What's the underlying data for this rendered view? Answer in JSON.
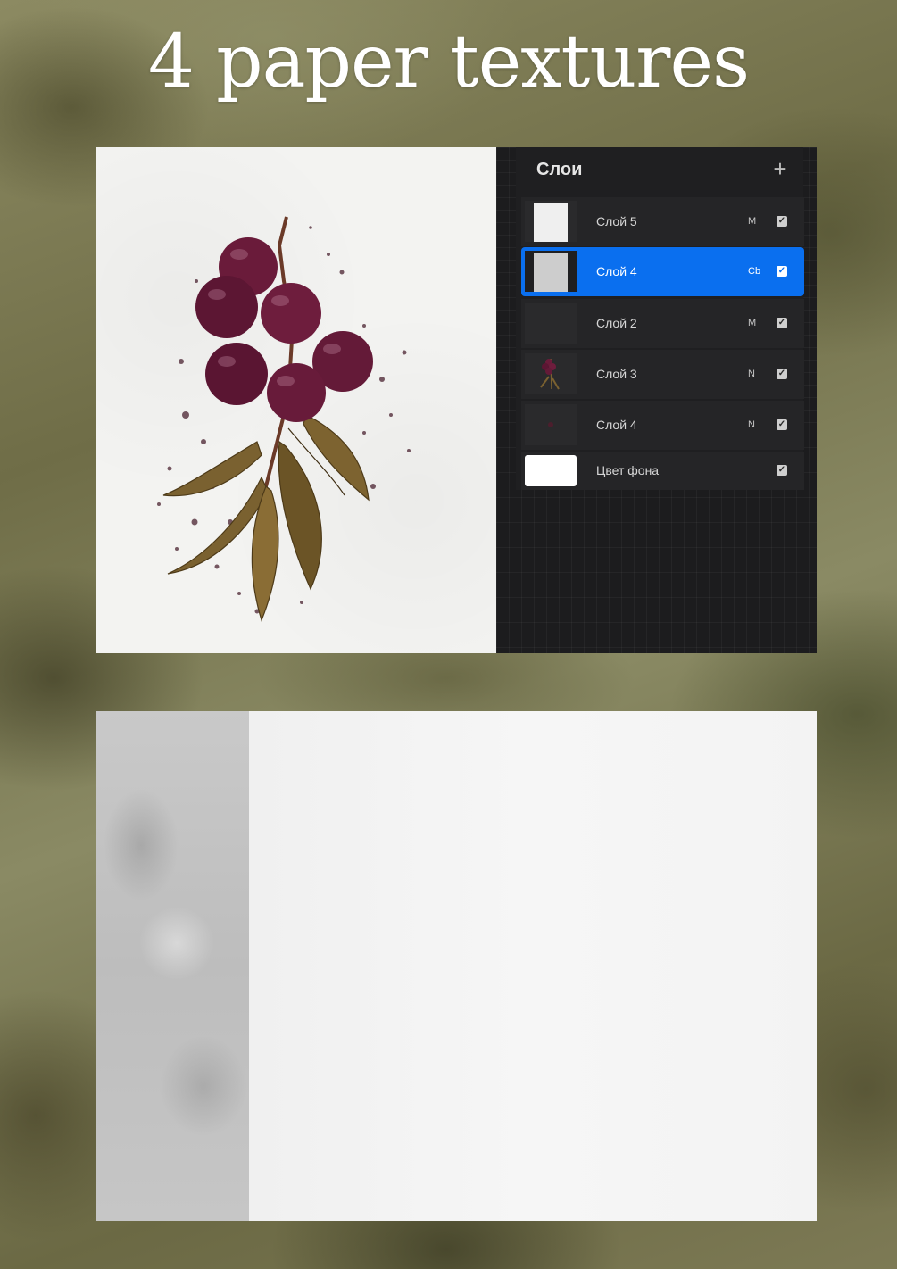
{
  "title": "4 paper textures",
  "layers_panel": {
    "title": "Слои",
    "add_icon": "plus-icon",
    "layers": [
      {
        "name": "Слой 5",
        "blend": "M",
        "visible": true,
        "active": false
      },
      {
        "name": "Слой 4",
        "blend": "Cb",
        "visible": true,
        "active": true
      },
      {
        "name": "Слой 2",
        "blend": "M",
        "visible": true,
        "active": false
      },
      {
        "name": "Слой 3",
        "blend": "N",
        "visible": true,
        "active": false
      },
      {
        "name": "Слой 4",
        "blend": "N",
        "visible": true,
        "active": false
      },
      {
        "name": "Цвет фона",
        "blend": "",
        "visible": true,
        "active": false
      }
    ]
  },
  "colors": {
    "accent": "#0a6fef",
    "panel_bg": "#1c1c1e",
    "berry": "#6a1b3a",
    "leaf": "#6e5a2a"
  }
}
